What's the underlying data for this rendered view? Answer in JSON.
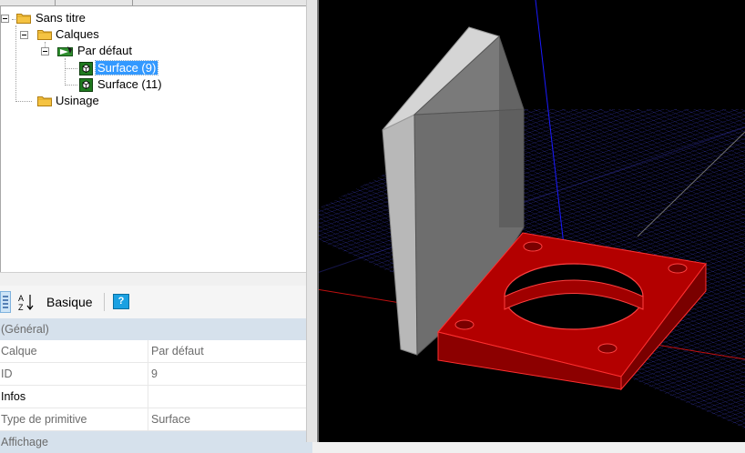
{
  "tree": {
    "root": "Sans titre",
    "layers": "Calques",
    "default_layer": "Par défaut",
    "surface_selected": "Surface (9)",
    "surface_other": "Surface (11)",
    "machining": "Usinage"
  },
  "toolbar": {
    "basic_label": "Basique",
    "help_glyph": "?"
  },
  "properties": {
    "category_general": "(Général)",
    "rows": [
      {
        "key": "Calque",
        "value": "Par défaut"
      },
      {
        "key": "ID",
        "value": "9"
      },
      {
        "key": "Infos",
        "value": ""
      },
      {
        "key": "Type de primitive",
        "value": "Surface"
      }
    ],
    "category_display": "Affichage"
  },
  "colors": {
    "selection": "#3399ff",
    "category_bg": "#d6e1ec",
    "part_red": "#b30000",
    "plate_gray": "#6e6e6e",
    "grid_blue": "#3030b0"
  }
}
